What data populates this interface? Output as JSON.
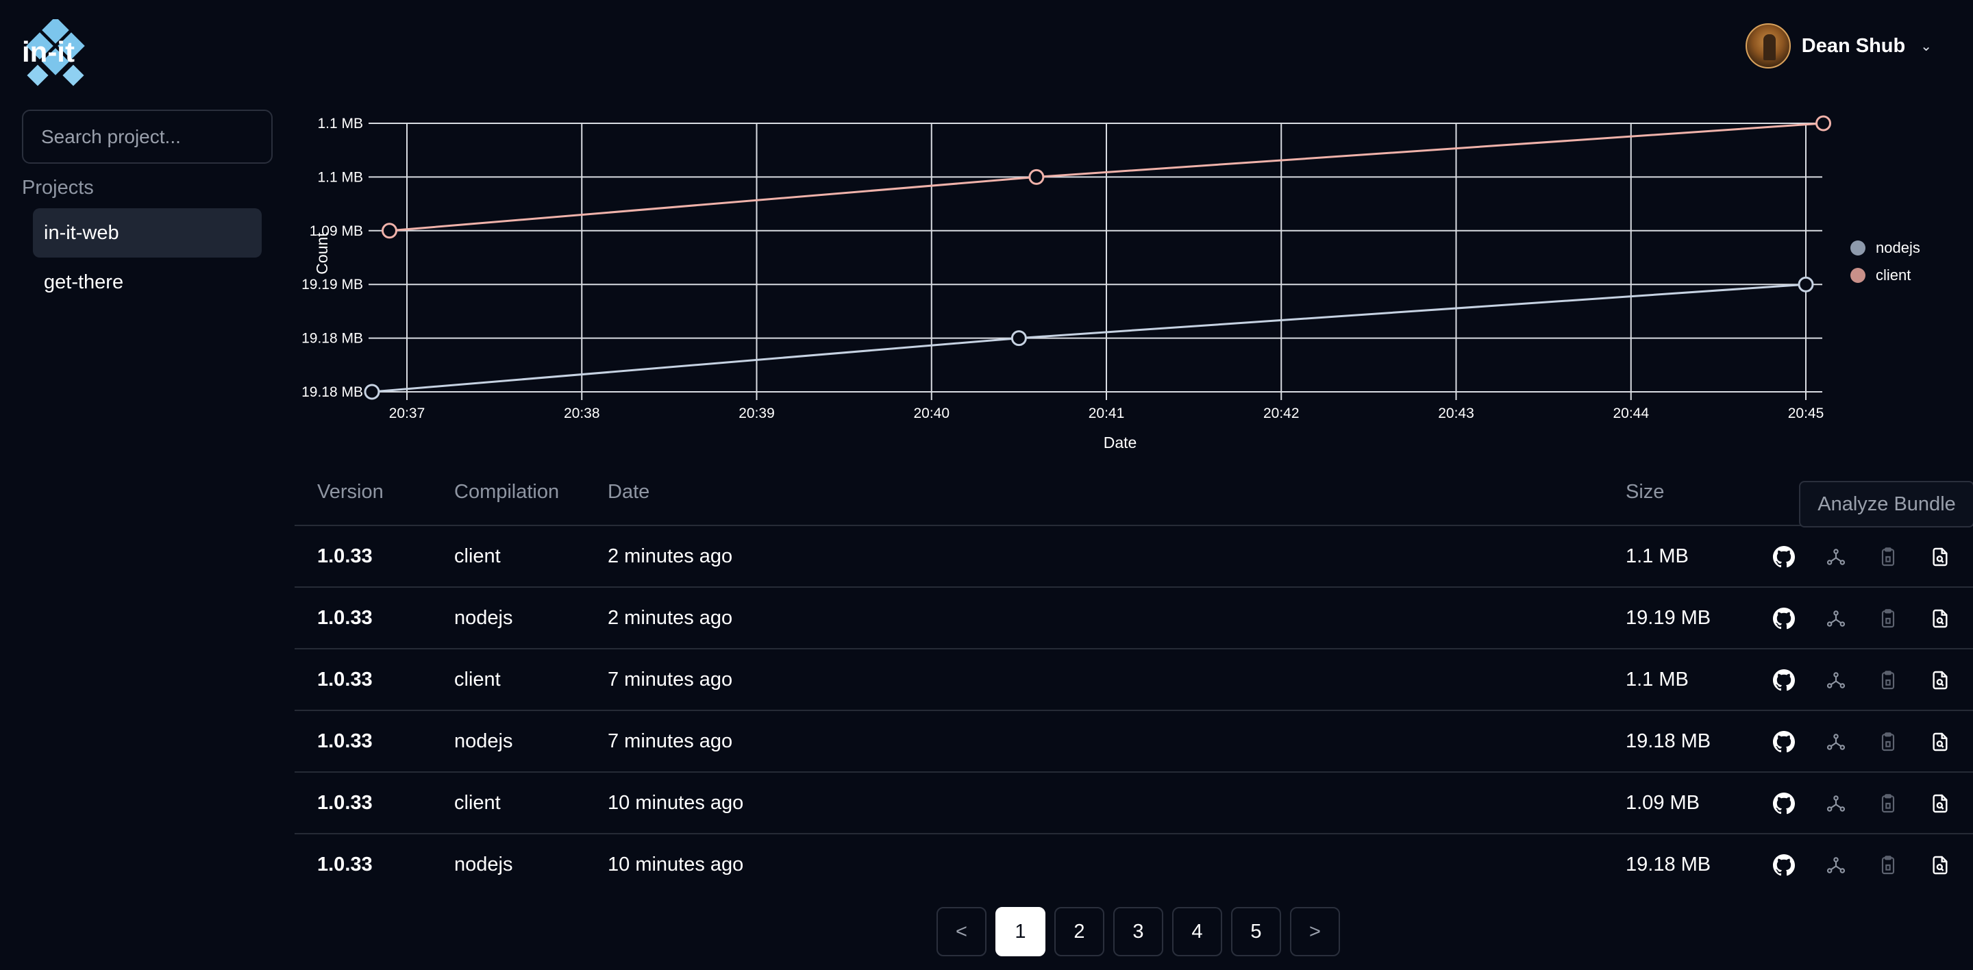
{
  "logo": {
    "text": "in-it"
  },
  "sidebar": {
    "search_placeholder": "Search project...",
    "section_label": "Projects",
    "projects": [
      {
        "label": "in-it-web",
        "active": true
      },
      {
        "label": "get-there",
        "active": false
      }
    ]
  },
  "header": {
    "user_name": "Dean Shub",
    "caret": "⌄"
  },
  "chart_data": {
    "type": "line",
    "xlabel": "Date",
    "ylabel": "Count",
    "x_ticks": [
      "20:37",
      "20:38",
      "20:39",
      "20:40",
      "20:41",
      "20:42",
      "20:43",
      "20:44",
      "20:45"
    ],
    "y_ticks": [
      "19.18 MB",
      "19.18 MB",
      "19.19 MB",
      "1.09 MB",
      "1.1 MB",
      "1.1 MB"
    ],
    "grid": true,
    "legend_position": "right",
    "series": [
      {
        "name": "nodejs",
        "color": "#c6d2e2",
        "legend_color": "#8e9aac",
        "x": [
          "20:36.8",
          "20:40.5",
          "20:45.0"
        ],
        "y": [
          "19.18 MB",
          "19.18 MB",
          "19.19 MB"
        ]
      },
      {
        "name": "client",
        "color": "#f0b2aa",
        "legend_color": "#c99089",
        "x": [
          "20:36.9",
          "20:40.6",
          "20:45.1"
        ],
        "y": [
          "1.09 MB",
          "1.1 MB",
          "1.1 MB"
        ]
      }
    ]
  },
  "table": {
    "headers": {
      "version": "Version",
      "compilation": "Compilation",
      "date": "Date",
      "size": "Size"
    },
    "analyze_label": "Analyze Bundle",
    "rows": [
      {
        "version": "1.0.33",
        "compilation": "client",
        "date": "2 minutes ago",
        "size": "1.1 MB"
      },
      {
        "version": "1.0.33",
        "compilation": "nodejs",
        "date": "2 minutes ago",
        "size": "19.19 MB"
      },
      {
        "version": "1.0.33",
        "compilation": "client",
        "date": "7 minutes ago",
        "size": "1.1 MB"
      },
      {
        "version": "1.0.33",
        "compilation": "nodejs",
        "date": "7 minutes ago",
        "size": "19.18 MB"
      },
      {
        "version": "1.0.33",
        "compilation": "client",
        "date": "10 minutes ago",
        "size": "1.09 MB"
      },
      {
        "version": "1.0.33",
        "compilation": "nodejs",
        "date": "10 minutes ago",
        "size": "19.18 MB"
      }
    ],
    "row_icons": [
      "github-icon",
      "graph-icon",
      "clipboard-icon",
      "file-search-icon"
    ]
  },
  "pagination": {
    "prev": "<",
    "next": ">",
    "pages": [
      "1",
      "2",
      "3",
      "4",
      "5"
    ],
    "current": "1"
  }
}
